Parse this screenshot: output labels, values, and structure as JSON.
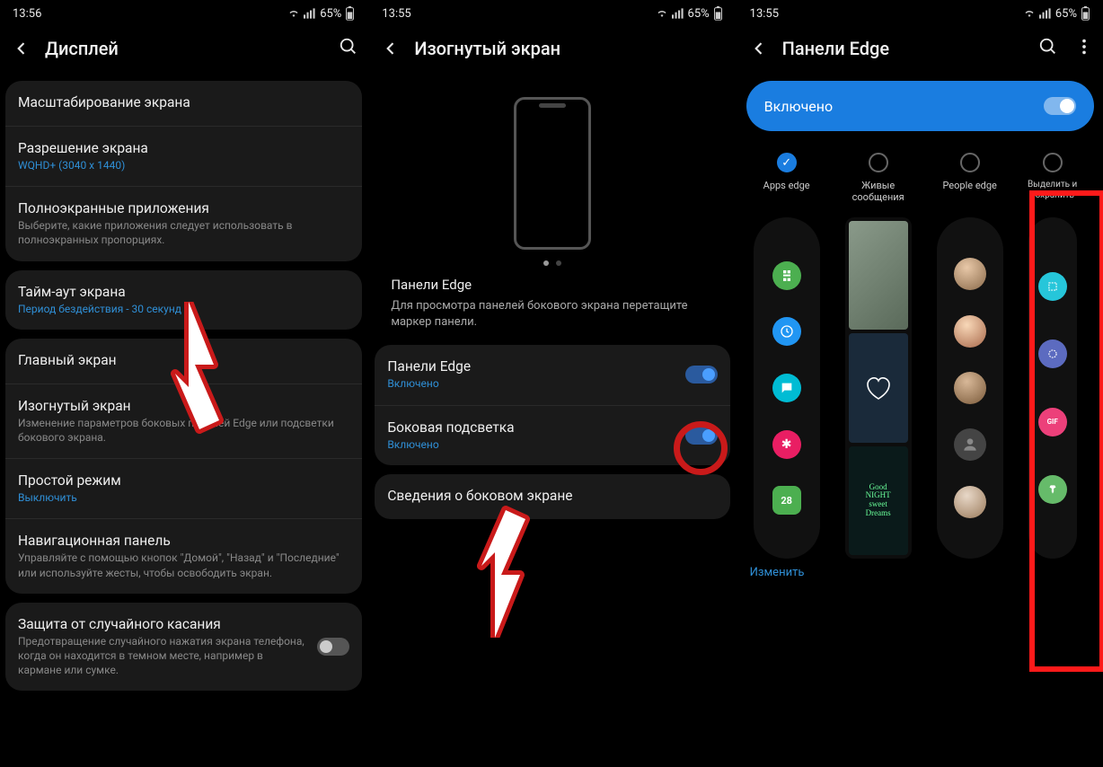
{
  "phone1": {
    "time": "13:56",
    "battery": "65%",
    "title": "Дисплей",
    "items": {
      "scale": {
        "title": "Масштабирование экрана"
      },
      "res": {
        "title": "Разрешение экрана",
        "sub": "WQHD+ (3040 x 1440)"
      },
      "fullscreen": {
        "title": "Полноэкранные приложения",
        "sub": "Выберите, какие приложения следует использовать в полноэкранных пропорциях."
      },
      "timeout": {
        "title": "Тайм-аут экрана",
        "sub": "Период бездействия - 30 секунд"
      },
      "home": {
        "title": "Главный экран"
      },
      "edge": {
        "title": "Изогнутый экран",
        "sub": "Изменение параметров боковых панелей Edge или подсветки бокового экрана."
      },
      "easy": {
        "title": "Простой режим",
        "sub": "Выключить"
      },
      "nav": {
        "title": "Навигационная панель",
        "sub": "Управляйте с помощью кнопок \"Домой\", \"Назад\" и \"Последние\" или используйте жесты, чтобы освободить экран."
      },
      "accident": {
        "title": "Защита от случайного касания",
        "sub": "Предотвращение случайного нажатия экрана телефона, когда он находится в темном месте, например в кармане или сумке."
      }
    }
  },
  "phone2": {
    "time": "13:55",
    "battery": "65%",
    "title": "Изогнутый экран",
    "desc_title": "Панели Edge",
    "desc_body": "Для просмотра панелей бокового экрана перетащите маркер панели.",
    "items": {
      "panels": {
        "title": "Панели Edge",
        "sub": "Включено"
      },
      "light": {
        "title": "Боковая подсветка",
        "sub": "Включено"
      },
      "info": {
        "title": "Сведения о боковом экране"
      }
    }
  },
  "phone3": {
    "time": "13:55",
    "battery": "65%",
    "title": "Панели Edge",
    "enabled": "Включено",
    "edit": "Изменить",
    "panels": {
      "p0": "Apps edge",
      "p1": "Живые сообщения",
      "p2": "People edge",
      "p3": "Выделить и сохранить"
    },
    "calendar_num": "28"
  }
}
